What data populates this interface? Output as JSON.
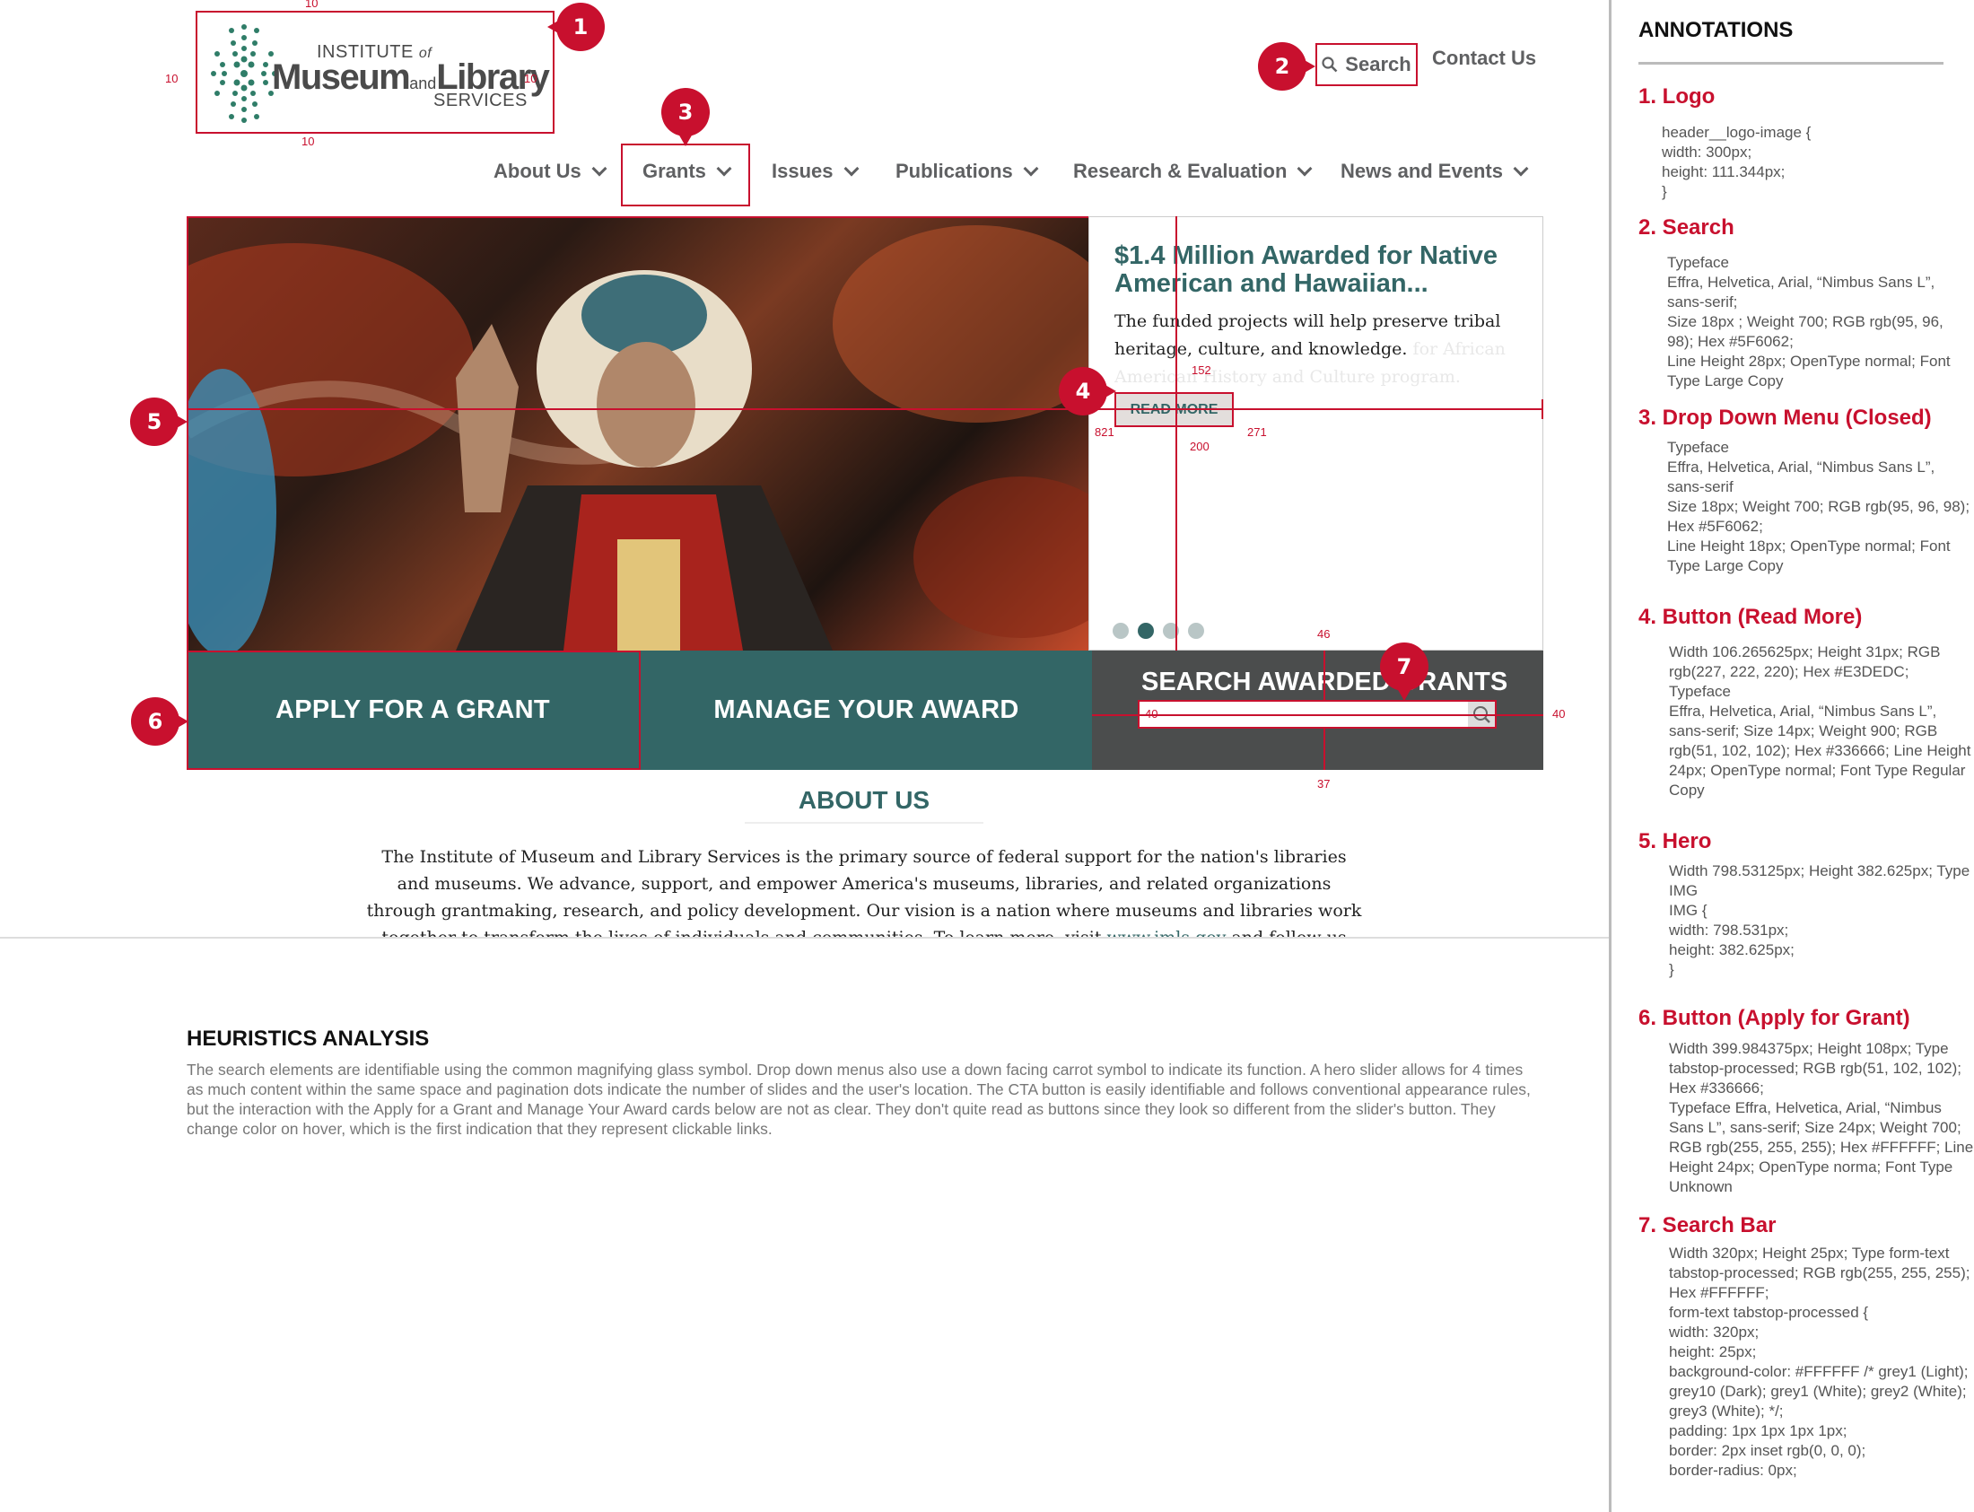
{
  "header": {
    "logo": {
      "line1": "INSTITUTE",
      "of": "of",
      "museum": "Museum",
      "and": "and",
      "library": "Library",
      "services": "SERVICES"
    },
    "search_label": "Search",
    "contact_label": "Contact Us"
  },
  "nav": {
    "items": [
      "About Us",
      "Grants",
      "Issues",
      "Publications",
      "Research & Evaluation",
      "News and Events"
    ]
  },
  "hero": {
    "title": "$1.4 Million Awarded for Native American and Hawaiian...",
    "description": "The funded projects will help preserve tribal heritage, culture, and knowledge.",
    "ghost_text": "for African American History and Culture program.",
    "read_more": "READ MORE"
  },
  "cta": {
    "apply": "APPLY FOR A GRANT",
    "manage": "MANAGE YOUR AWARD",
    "search_grants": "SEARCH AWARDED GRANTS"
  },
  "about": {
    "title": "ABOUT US",
    "text": "The Institute of Museum and Library Services is the primary source of federal support for the nation's libraries and museums. We advance, support, and empower America's museums, libraries, and related organizations through grantmaking, research, and policy development. Our vision is a nation where museums and libraries work together to transform the lives of individuals and communities. To learn more, visit",
    "link": "www.imls.gov",
    "text_after": "and follow us"
  },
  "measurements": {
    "logo_pad_top": "10",
    "logo_pad_left": "10",
    "logo_pad_right": "10",
    "logo_pad_bottom": "10",
    "hero_v": "152",
    "hero_left": "821",
    "hero_right": "271",
    "hero_bottom": "200",
    "sg_top": "46",
    "sg_left": "40",
    "sg_right": "40",
    "sg_bottom": "37"
  },
  "markers": [
    "1",
    "2",
    "3",
    "4",
    "5",
    "6",
    "7"
  ],
  "heuristics": {
    "title": "HEURISTICS ANALYSIS",
    "text": "The search elements are identifiable using the common magnifying glass symbol. Drop down menus also use a down facing carrot symbol to indicate its function. A hero slider allows for 4 times as much content within the same space and pagination dots indicate the number of slides and the user's location. The CTA button is easily identifiable and follows conventional appearance rules, but the interaction with the Apply for a Grant and Manage Your Award cards below are not as clear. They don't quite read as buttons since they look so different from the slider's button. They change color on hover, which is the first indication that they represent clickable links."
  },
  "annotations": {
    "title": "ANNOTATIONS",
    "items": [
      {
        "title": "1. Logo",
        "body": "header__logo-image {\nwidth: 300px;\nheight: 111.344px;\n}"
      },
      {
        "title": "2. Search",
        "body": "Typeface\nEffra, Helvetica, Arial, “Nimbus Sans L”, sans-serif;\nSize 18px ; Weight 700; RGB rgb(95, 96, 98); Hex #5F6062;\nLine Height 28px; OpenType normal; Font Type Large Copy"
      },
      {
        "title": "3. Drop Down Menu (Closed)",
        "body": "Typeface\nEffra, Helvetica, Arial, “Nimbus Sans L”, sans-serif\nSize 18px; Weight 700;  RGB rgb(95, 96, 98); Hex #5F6062;\nLine Height 18px; OpenType normal; Font Type Large Copy"
      },
      {
        "title": "4. Button (Read More)",
        "body": "Width 106.265625px; Height 31px; RGB rgb(227, 222, 220); Hex #E3DEDC; Typeface\nEffra, Helvetica, Arial, “Nimbus Sans L”, sans-serif; Size 14px; Weight 900; RGB rgb(51, 102, 102); Hex #336666; Line Height 24px; OpenType normal; Font Type Regular Copy"
      },
      {
        "title": "5. Hero",
        "body": "Width 798.53125px; Height 382.625px; Type IMG\nIMG  {\nwidth: 798.531px;\nheight: 382.625px;\n}"
      },
      {
        "title": "6. Button (Apply for Grant)",
        "body": "Width 399.984375px; Height 108px; Type tabstop-processed; RGB rgb(51, 102, 102); Hex #336666;\nTypeface Effra, Helvetica, Arial, “Nimbus Sans L”, sans-serif; Size 24px; Weight 700; RGB rgb(255, 255, 255); Hex #FFFFFF; Line Height 24px; OpenType norma; Font Type Unknown"
      },
      {
        "title": "7. Search Bar",
        "body": "Width 320px; Height 25px; Type form-text tabstop-processed; RGB rgb(255, 255, 255); Hex #FFFFFF;\nform-text tabstop-processed  {\nwidth: 320px;\nheight: 25px;\nbackground-color: #FFFFFF /* grey1 (Light); grey10 (Dark); grey1 (White); grey2 (White); grey3 (White); */;\npadding: 1px 1px 1px 1px;\nborder: 2px inset rgb(0, 0, 0);\nborder-radius: 0px;"
      }
    ]
  },
  "colors": {
    "teal": "#336666",
    "grey_text": "#5F6062",
    "annotation_red": "#c8102e",
    "button_bg": "#E3DEDC",
    "search_panel": "#4b4d4d"
  }
}
